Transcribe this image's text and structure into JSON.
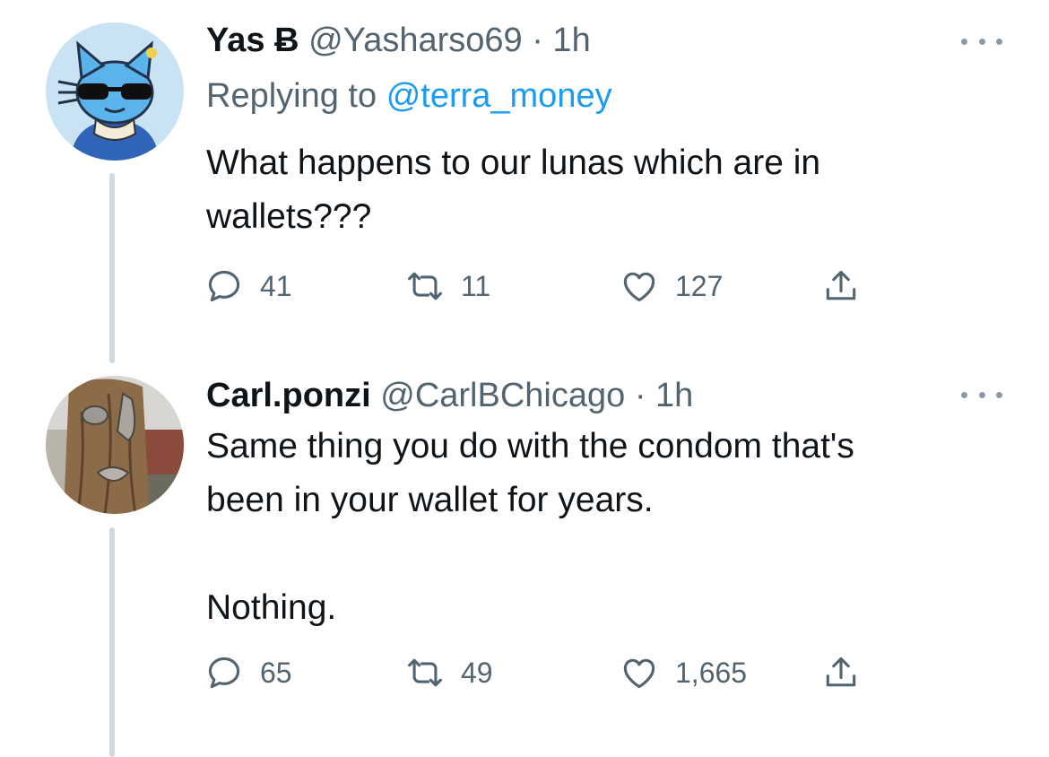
{
  "tweets": [
    {
      "name": "Yas Ƀ",
      "handle": "@Yasharso69",
      "time": "· 1h",
      "replying_label": "Replying to",
      "replying_handle": "@terra_money",
      "text_lines": [
        "What happens to our lunas which are in",
        "wallets???"
      ],
      "avatar": "cartoon-cat-with-sunglasses",
      "stats": {
        "replies": "41",
        "retweets": "11",
        "likes": "127"
      }
    },
    {
      "name": "Carl.ponzi",
      "handle": "@CarlBChicago",
      "time": "· 1h",
      "text_lines": [
        "Same thing you do with the condom that's",
        "been in your wallet for years.",
        "",
        "Nothing."
      ],
      "avatar": "tree-face-sculpture",
      "stats": {
        "replies": "65",
        "retweets": "49",
        "likes": "1,665"
      }
    }
  ],
  "colors": {
    "text": "#0f1419",
    "secondary": "#536471",
    "link": "#1d9bf0",
    "thread_line": "#cfd9de"
  },
  "icons": [
    "reply-icon",
    "retweet-icon",
    "like-icon",
    "share-icon",
    "more-options-icon"
  ]
}
